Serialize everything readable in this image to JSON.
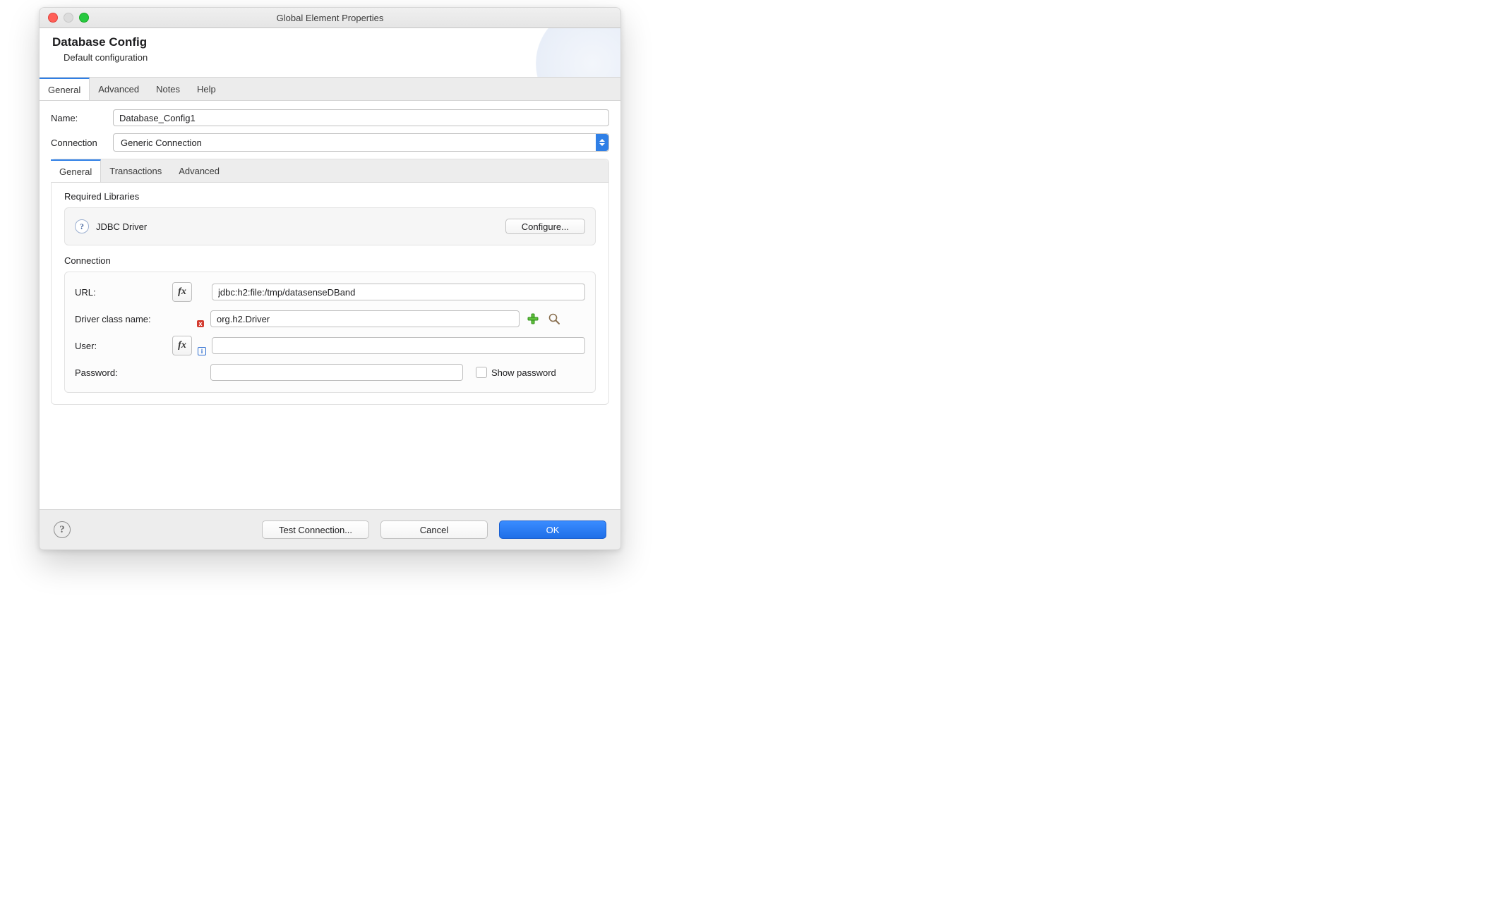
{
  "window": {
    "title": "Global Element Properties"
  },
  "header": {
    "title": "Database Config",
    "subtitle": "Default configuration"
  },
  "tabs": {
    "items": [
      "General",
      "Advanced",
      "Notes",
      "Help"
    ],
    "active": 0
  },
  "form": {
    "name_label": "Name:",
    "name_value": "Database_Config1",
    "connection_label": "Connection",
    "connection_value": "Generic Connection"
  },
  "inner_tabs": {
    "items": [
      "General",
      "Transactions",
      "Advanced"
    ],
    "active": 0
  },
  "libraries": {
    "section_label": "Required Libraries",
    "driver_label": "JDBC Driver",
    "configure_label": "Configure..."
  },
  "connection": {
    "section_label": "Connection",
    "url_label": "URL:",
    "url_value": "jdbc:h2:file:/tmp/datasenseDBand",
    "driver_class_label": "Driver class name:",
    "driver_class_value": "org.h2.Driver",
    "user_label": "User:",
    "user_value": "",
    "password_label": "Password:",
    "password_value": "",
    "show_password_label": "Show password"
  },
  "buttons": {
    "test": "Test Connection...",
    "cancel": "Cancel",
    "ok": "OK"
  },
  "fx_label": "fx"
}
